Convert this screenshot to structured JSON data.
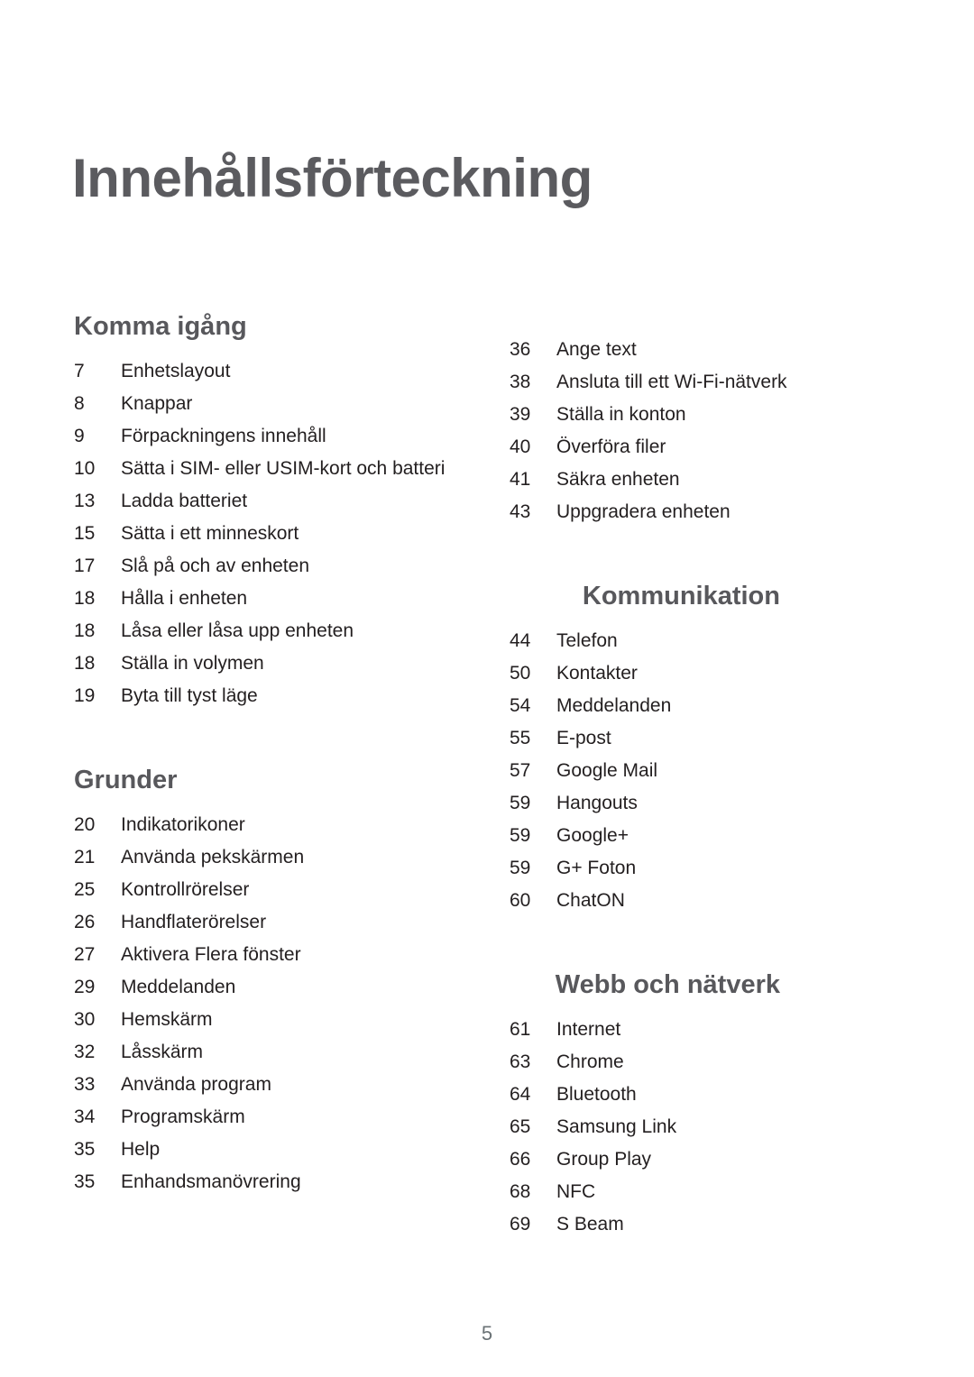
{
  "document": {
    "title": "Innehållsförteckning",
    "page_number": "5",
    "colors": {
      "title": "#5b5b5f",
      "heading": "#58585c",
      "body": "#231f20",
      "folio": "#6a7275",
      "background": "#ffffff"
    }
  },
  "left_column": {
    "sections": [
      {
        "heading": "Komma igång",
        "entries": [
          {
            "page": "7",
            "title": "Enhetslayout"
          },
          {
            "page": "8",
            "title": "Knappar"
          },
          {
            "page": "9",
            "title": "Förpackningens innehåll"
          },
          {
            "page": "10",
            "title": "Sätta i SIM- eller USIM-kort och batteri"
          },
          {
            "page": "13",
            "title": "Ladda batteriet"
          },
          {
            "page": "15",
            "title": "Sätta i ett minneskort"
          },
          {
            "page": "17",
            "title": "Slå på och av enheten"
          },
          {
            "page": "18",
            "title": "Hålla i enheten"
          },
          {
            "page": "18",
            "title": "Låsa eller låsa upp enheten"
          },
          {
            "page": "18",
            "title": "Ställa in volymen"
          },
          {
            "page": "19",
            "title": "Byta till tyst läge"
          }
        ]
      },
      {
        "heading": "Grunder",
        "entries": [
          {
            "page": "20",
            "title": "Indikatorikoner"
          },
          {
            "page": "21",
            "title": "Använda pekskärmen"
          },
          {
            "page": "25",
            "title": "Kontrollrörelser"
          },
          {
            "page": "26",
            "title": "Handflaterörelser"
          },
          {
            "page": "27",
            "title": "Aktivera Flera fönster"
          },
          {
            "page": "29",
            "title": "Meddelanden"
          },
          {
            "page": "30",
            "title": "Hemskärm"
          },
          {
            "page": "32",
            "title": "Låsskärm"
          },
          {
            "page": "33",
            "title": "Använda program"
          },
          {
            "page": "34",
            "title": "Programskärm"
          },
          {
            "page": "35",
            "title": "Help"
          },
          {
            "page": "35",
            "title": "Enhandsmanövrering"
          }
        ]
      }
    ]
  },
  "right_column": {
    "continued_entries": [
      {
        "page": "36",
        "title": "Ange text"
      },
      {
        "page": "38",
        "title": "Ansluta till ett Wi-Fi-nätverk"
      },
      {
        "page": "39",
        "title": "Ställa in konton"
      },
      {
        "page": "40",
        "title": "Överföra filer"
      },
      {
        "page": "41",
        "title": "Säkra enheten"
      },
      {
        "page": "43",
        "title": "Uppgradera enheten"
      }
    ],
    "sections": [
      {
        "heading": "Kommunikation",
        "entries": [
          {
            "page": "44",
            "title": "Telefon"
          },
          {
            "page": "50",
            "title": "Kontakter"
          },
          {
            "page": "54",
            "title": "Meddelanden"
          },
          {
            "page": "55",
            "title": "E-post"
          },
          {
            "page": "57",
            "title": "Google Mail"
          },
          {
            "page": "59",
            "title": "Hangouts"
          },
          {
            "page": "59",
            "title": "Google+"
          },
          {
            "page": "59",
            "title": "G+ Foton"
          },
          {
            "page": "60",
            "title": "ChatON"
          }
        ]
      },
      {
        "heading": "Webb och nätverk",
        "entries": [
          {
            "page": "61",
            "title": "Internet"
          },
          {
            "page": "63",
            "title": "Chrome"
          },
          {
            "page": "64",
            "title": "Bluetooth"
          },
          {
            "page": "65",
            "title": "Samsung Link"
          },
          {
            "page": "66",
            "title": "Group Play"
          },
          {
            "page": "68",
            "title": "NFC"
          },
          {
            "page": "69",
            "title": "S Beam"
          }
        ]
      }
    ]
  }
}
